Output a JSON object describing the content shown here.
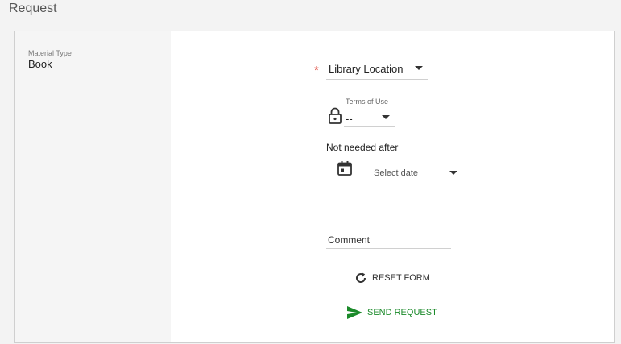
{
  "page": {
    "title": "Request"
  },
  "material": {
    "label": "Material Type",
    "value": "Book"
  },
  "form": {
    "library_location": {
      "required_mark": "*",
      "value": "Library Location"
    },
    "terms_of_use": {
      "label": "Terms of Use",
      "value": "--"
    },
    "not_needed_after": {
      "label": "Not needed after",
      "placeholder": "Select date"
    },
    "comment": {
      "placeholder": "Comment"
    },
    "reset_label": "RESET FORM",
    "send_label": "SEND REQUEST"
  },
  "colors": {
    "required": "#e2574c",
    "send": "#1b8a2a"
  },
  "icons": {
    "terms": "lock-icon",
    "date": "calendar-icon",
    "reset": "refresh-icon",
    "send": "send-arrow-icon"
  }
}
